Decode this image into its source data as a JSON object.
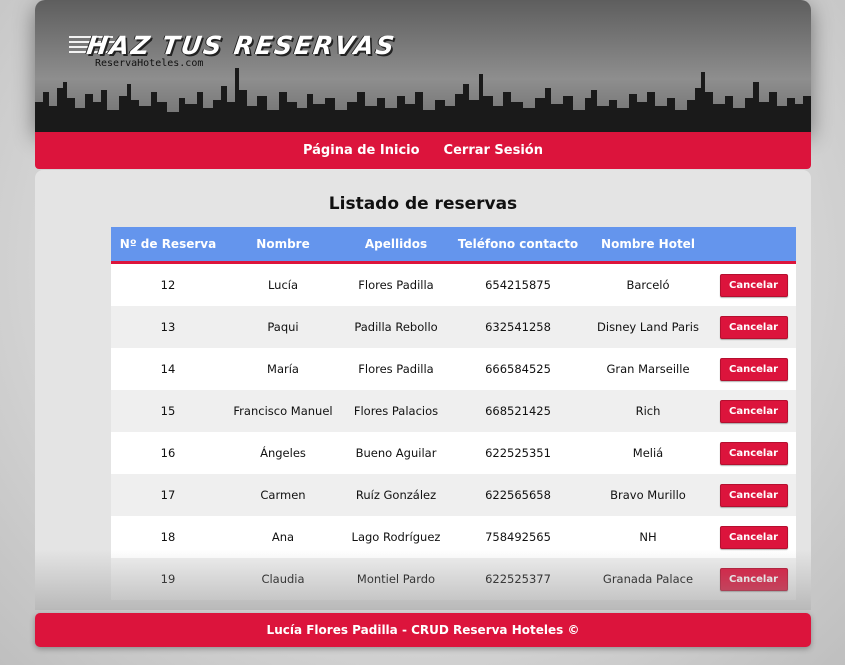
{
  "header": {
    "title": "HAZ TUS RESERVAS",
    "subtitle": "ReservaHoteles.com"
  },
  "nav": {
    "home_label": "Página de Inicio",
    "logout_label": "Cerrar Sesión"
  },
  "main": {
    "title": "Listado de reservas"
  },
  "table": {
    "headers": [
      "Nº de Reserva",
      "Nombre",
      "Apellidos",
      "Teléfono contacto",
      "Nombre Hotel"
    ],
    "cancel_label": "Cancelar",
    "rows": [
      {
        "id": "12",
        "nombre": "Lucía",
        "apellidos": "Flores Padilla",
        "telefono": "654215875",
        "hotel": "Barceló"
      },
      {
        "id": "13",
        "nombre": "Paqui",
        "apellidos": "Padilla Rebollo",
        "telefono": "632541258",
        "hotel": "Disney Land Paris"
      },
      {
        "id": "14",
        "nombre": "María",
        "apellidos": "Flores Padilla",
        "telefono": "666584525",
        "hotel": "Gran Marseille"
      },
      {
        "id": "15",
        "nombre": "Francisco Manuel",
        "apellidos": "Flores Palacios",
        "telefono": "668521425",
        "hotel": "Rich"
      },
      {
        "id": "16",
        "nombre": "Ángeles",
        "apellidos": "Bueno Aguilar",
        "telefono": "622525351",
        "hotel": "Meliá"
      },
      {
        "id": "17",
        "nombre": "Carmen",
        "apellidos": "Ruíz González",
        "telefono": "622565658",
        "hotel": "Bravo Murillo"
      },
      {
        "id": "18",
        "nombre": "Ana",
        "apellidos": "Lago Rodríguez",
        "telefono": "758492565",
        "hotel": "NH"
      },
      {
        "id": "19",
        "nombre": "Claudia",
        "apellidos": "Montiel Pardo",
        "telefono": "622525377",
        "hotel": "Granada Palace"
      }
    ]
  },
  "footer": {
    "text": "Lucía Flores Padilla - CRUD Reserva Hoteles ©"
  },
  "colors": {
    "accent": "#dc143c",
    "table_header": "#6495ed"
  }
}
